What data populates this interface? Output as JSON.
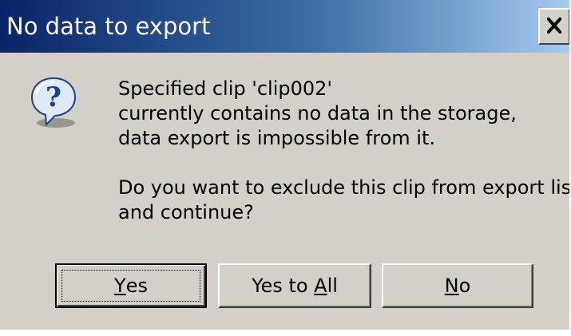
{
  "dialog": {
    "title": "No data to export",
    "icon": "question-icon",
    "close_icon": "close-icon"
  },
  "message": {
    "line1": "Specified clip 'clip002'",
    "line2": "currently contains no data in the storage,",
    "line3": "data export is impossible from it.",
    "line4": "Do you want to exclude this clip from export list",
    "line5": "and continue?"
  },
  "buttons": {
    "yes": {
      "mnemonic": "Y",
      "rest": "es"
    },
    "yes_to_all": {
      "prefix": "Yes to ",
      "mnemonic": "A",
      "rest": "ll"
    },
    "no": {
      "mnemonic": "N",
      "rest": "o"
    }
  },
  "colors": {
    "title_start": "#0a246a",
    "title_end": "#a6caf0",
    "face": "#d4d0c8",
    "icon_bubble": "#dfe9f7",
    "icon_mark": "#1a3f9a"
  }
}
